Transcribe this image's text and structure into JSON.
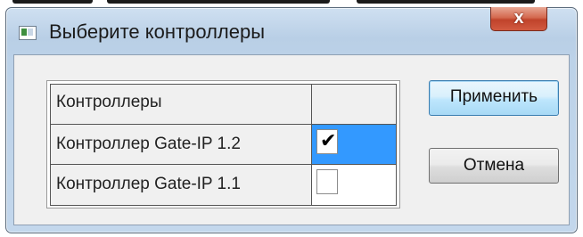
{
  "window": {
    "title": "Выберите контроллеры",
    "close_label": "x"
  },
  "grid": {
    "header": {
      "name": "Контроллеры",
      "check": ""
    },
    "rows": [
      {
        "name": "Контроллер Gate-IP 1.2",
        "checked": true,
        "selected": true,
        "check_glyph": "✔"
      },
      {
        "name": "Контроллер Gate-IP 1.1",
        "checked": false,
        "selected": false,
        "check_glyph": ""
      }
    ]
  },
  "buttons": {
    "apply_label": "Применить",
    "cancel_label": "Отмена"
  },
  "colors": {
    "selection": "#3399ff",
    "close_button": "#c0432b",
    "default_button_border": "#3c7fb1"
  }
}
